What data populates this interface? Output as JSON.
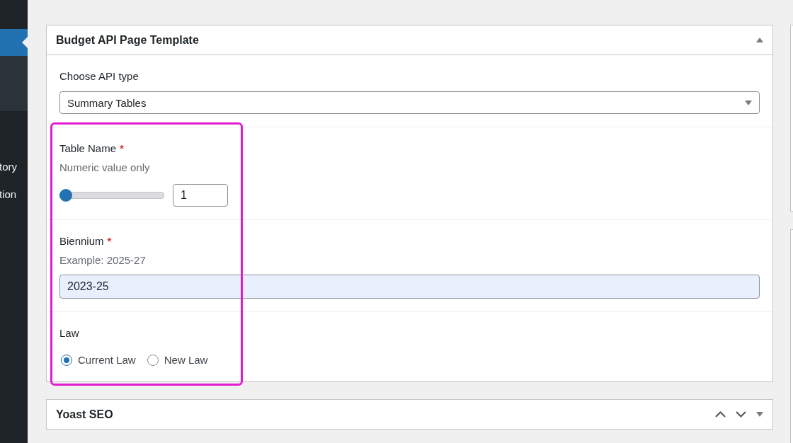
{
  "sidebar": {
    "items": [
      {
        "selected": true
      },
      {
        "label": "tory",
        "selected": false
      },
      {
        "label": "tion",
        "selected": false
      }
    ]
  },
  "panel": {
    "title": "Budget API Page Template",
    "expanded": true,
    "api_type": {
      "label": "Choose API type",
      "value": "Summary Tables"
    },
    "table_name": {
      "label": "Table Name",
      "required": true,
      "hint": "Numeric value only",
      "level": 0,
      "value": "1"
    },
    "biennium": {
      "label": "Biennium",
      "required": true,
      "hint": "Example: 2025-27",
      "value": "2023-25"
    },
    "law": {
      "label": "Law",
      "options": [
        {
          "label": "Current Law",
          "selected": true
        },
        {
          "label": "New Law",
          "selected": false
        }
      ]
    },
    "required_mark": "*"
  },
  "yoast": {
    "title": "Yoast SEO",
    "expanded": false
  }
}
